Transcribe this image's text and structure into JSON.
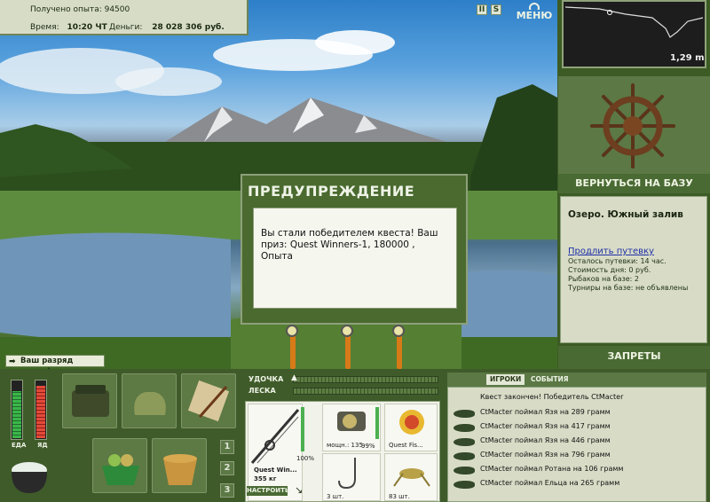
{
  "status": {
    "experience_label": "Получено опыта: 94500",
    "time_label": "Время:",
    "time_value": "10:20 ЧТ",
    "money_label": "Деньги:",
    "money_value": "28 028 306 руб."
  },
  "top_buttons": {
    "pause": "II",
    "sound": "S",
    "menu": "МЕНЮ"
  },
  "depth": {
    "value": "1,29 m"
  },
  "right_panel": {
    "return_button": "ВЕРНУТЬСЯ НА БАЗУ",
    "place": "Озеро. Южный залив",
    "extend_link": "Продлить путевку",
    "lines": [
      "Осталось путевки: 14 час.",
      "Стоимость дня: 0 руб.",
      "Рыбаков на базе: 2",
      "Турниры на базе: не объявлены"
    ],
    "bans_button": "ЗАПРЕТЫ"
  },
  "dialog": {
    "title": "ПРЕДУПРЕЖДЕНИЕ",
    "text": "Вы стали победителем квеста! Ваш приз: Quest Winners-1, 180000 , Опыта"
  },
  "rank_banner": "Ваш разряд вырос!",
  "meters": {
    "food_label": "ЕДА",
    "poison_label": "ЯД",
    "food_level": 0.8,
    "poison_level": 0.9
  },
  "bag_tabs": [
    "1",
    "2",
    "3"
  ],
  "gear_bars": {
    "rod_label": "УДОЧКА",
    "line_label": "ЛЕСКА"
  },
  "tackle": {
    "rod_name": "Quest Win...",
    "rod_weight": "355 кг",
    "rod_percent": "100%",
    "reel_caption": "мощн.: 135",
    "reel_percent": "99%",
    "lure_caption": "Quest Fis...",
    "hook_caption": "3 шт.",
    "bait_caption": "83 шт.",
    "setup_button": "НАСТРОИТЬ"
  },
  "events": {
    "tab_players": "ИГРОКИ",
    "tab_events": "СОБЫТИЯ",
    "headline": "Квест закончен! Победитель CtMacter",
    "rows": [
      "CtMacter поймал Язя на 289 грамм",
      "CtMacter поймал Язя на 417 грамм",
      "CtMacter поймал Язя на 446 грамм",
      "CtMacter поймал Язя на 796 грамм",
      "CtMacter поймал Ротана на 106 грамм",
      "CtMacter поймал Ельца на 265 грамм"
    ]
  }
}
